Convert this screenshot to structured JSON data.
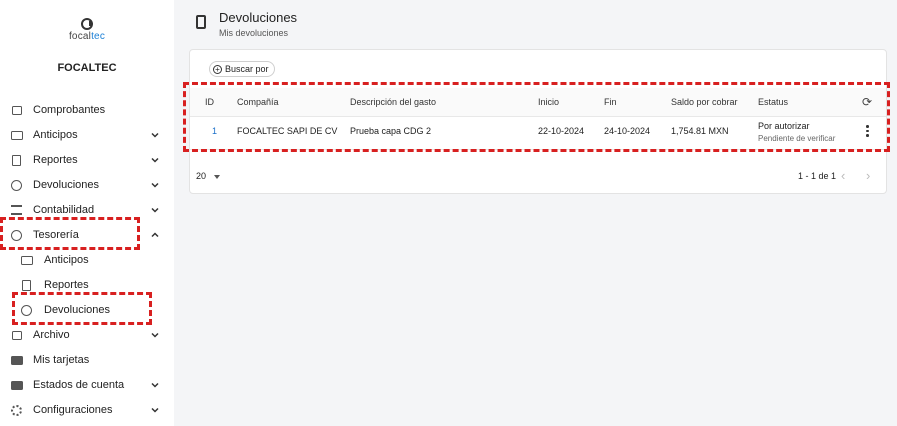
{
  "sidebar": {
    "logo_text_a": "focal",
    "logo_text_b": "tec",
    "org_name": "FOCALTEC",
    "items": [
      {
        "label": "Comprobantes"
      },
      {
        "label": "Anticipos"
      },
      {
        "label": "Reportes"
      },
      {
        "label": "Devoluciones"
      },
      {
        "label": "Contabilidad"
      },
      {
        "label": "Tesorería"
      },
      {
        "label": "Anticipos"
      },
      {
        "label": "Reportes"
      },
      {
        "label": "Devoluciones"
      },
      {
        "label": "Archivo"
      },
      {
        "label": "Mis tarjetas"
      },
      {
        "label": "Estados de cuenta"
      },
      {
        "label": "Configuraciones"
      }
    ]
  },
  "header": {
    "title": "Devoluciones",
    "subtitle": "Mis devoluciones"
  },
  "toolbar": {
    "search_label": "Buscar por"
  },
  "table": {
    "columns": [
      "ID",
      "Compañía",
      "Descripción del gasto",
      "Inicio",
      "Fin",
      "Saldo por cobrar",
      "Estatus"
    ],
    "rows": [
      {
        "id": "1",
        "company": "FOCALTEC SAPI DE CV",
        "description": "Prueba capa CDG 2",
        "start": "22-10-2024",
        "end": "24-10-2024",
        "balance": "1,754.81 MXN",
        "status": "Por autorizar",
        "status_detail": "Pendiente de verificar"
      }
    ]
  },
  "pagination": {
    "page_size": "20",
    "range": "1 - 1 de 1"
  },
  "colors": {
    "accent": "#1a6fc9",
    "highlight": "#d82020"
  }
}
